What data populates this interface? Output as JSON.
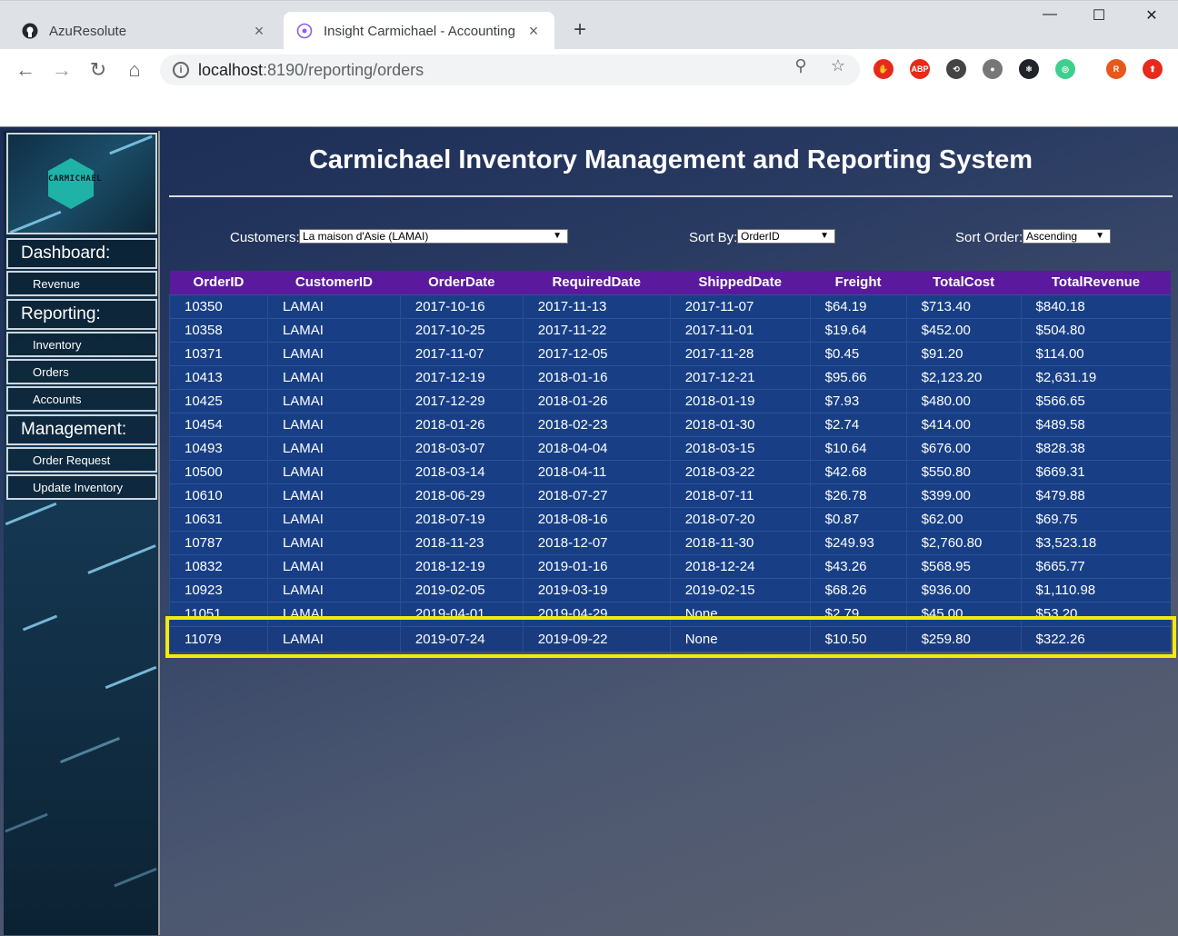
{
  "browser": {
    "tabs": [
      {
        "title": "AzuResolute",
        "icon": "github-icon",
        "active": false
      },
      {
        "title": "Insight Carmichael - Accounting",
        "icon": "app-favicon-icon",
        "active": true
      }
    ],
    "new_tab_glyph": "+",
    "window_controls": {
      "minimize": "—",
      "maximize": "☐",
      "close": "✕"
    },
    "nav": {
      "back": "←",
      "forward": "→",
      "reload": "↻",
      "home": "⌂"
    },
    "url_host": "localhost",
    "url_path": ":8190/reporting/orders",
    "omnibox_icons": {
      "zoom": "⚲",
      "bookmark": "☆"
    },
    "extensions": [
      {
        "name": "ublock-icon",
        "label": "✋",
        "color": "#e8291c"
      },
      {
        "name": "adblock-plus-icon",
        "label": "ABP",
        "color": "#e8291c"
      },
      {
        "name": "extension-circle-icon",
        "label": "⟲",
        "color": "#444444"
      },
      {
        "name": "extension-sphere-icon",
        "label": "●",
        "color": "#777777"
      },
      {
        "name": "react-devtools-icon",
        "label": "⚛",
        "color": "#20232a"
      },
      {
        "name": "extension-target-icon",
        "label": "◎",
        "color": "#3ecf8e"
      },
      {
        "name": "profile-avatar-icon",
        "label": "R",
        "color": "#e8571c"
      },
      {
        "name": "update-icon",
        "label": "⬆",
        "color": "#e8291c"
      }
    ]
  },
  "sidebar": {
    "logo_text": "CARMICHAEL",
    "sections": [
      {
        "heading": "Dashboard:",
        "items": [
          "Revenue"
        ]
      },
      {
        "heading": "Reporting:",
        "items": [
          "Inventory",
          "Orders",
          "Accounts"
        ]
      },
      {
        "heading": "Management:",
        "items": [
          "Order Request",
          "Update Inventory"
        ]
      }
    ]
  },
  "main": {
    "title": "Carmichael Inventory Management and Reporting System",
    "filters": {
      "customers_label": "Customers:",
      "customers_value": "La maison d'Asie (LAMAI)",
      "sort_by_label": "Sort By:",
      "sort_by_value": "OrderID",
      "sort_order_label": "Sort Order:",
      "sort_order_value": "Ascending",
      "dropdown_arrow": "▼"
    },
    "table": {
      "columns": [
        "OrderID",
        "CustomerID",
        "OrderDate",
        "RequiredDate",
        "ShippedDate",
        "Freight",
        "TotalCost",
        "TotalRevenue"
      ],
      "rows": [
        [
          "10350",
          "LAMAI",
          "2017-10-16",
          "2017-11-13",
          "2017-11-07",
          "$64.19",
          "$713.40",
          "$840.18"
        ],
        [
          "10358",
          "LAMAI",
          "2017-10-25",
          "2017-11-22",
          "2017-11-01",
          "$19.64",
          "$452.00",
          "$504.80"
        ],
        [
          "10371",
          "LAMAI",
          "2017-11-07",
          "2017-12-05",
          "2017-11-28",
          "$0.45",
          "$91.20",
          "$114.00"
        ],
        [
          "10413",
          "LAMAI",
          "2017-12-19",
          "2018-01-16",
          "2017-12-21",
          "$95.66",
          "$2,123.20",
          "$2,631.19"
        ],
        [
          "10425",
          "LAMAI",
          "2017-12-29",
          "2018-01-26",
          "2018-01-19",
          "$7.93",
          "$480.00",
          "$566.65"
        ],
        [
          "10454",
          "LAMAI",
          "2018-01-26",
          "2018-02-23",
          "2018-01-30",
          "$2.74",
          "$414.00",
          "$489.58"
        ],
        [
          "10493",
          "LAMAI",
          "2018-03-07",
          "2018-04-04",
          "2018-03-15",
          "$10.64",
          "$676.00",
          "$828.38"
        ],
        [
          "10500",
          "LAMAI",
          "2018-03-14",
          "2018-04-11",
          "2018-03-22",
          "$42.68",
          "$550.80",
          "$669.31"
        ],
        [
          "10610",
          "LAMAI",
          "2018-06-29",
          "2018-07-27",
          "2018-07-11",
          "$26.78",
          "$399.00",
          "$479.88"
        ],
        [
          "10631",
          "LAMAI",
          "2018-07-19",
          "2018-08-16",
          "2018-07-20",
          "$0.87",
          "$62.00",
          "$69.75"
        ],
        [
          "10787",
          "LAMAI",
          "2018-11-23",
          "2018-12-07",
          "2018-11-30",
          "$249.93",
          "$2,760.80",
          "$3,523.18"
        ],
        [
          "10832",
          "LAMAI",
          "2018-12-19",
          "2019-01-16",
          "2018-12-24",
          "$43.26",
          "$568.95",
          "$665.77"
        ],
        [
          "10923",
          "LAMAI",
          "2019-02-05",
          "2019-03-19",
          "2019-02-15",
          "$68.26",
          "$936.00",
          "$1,110.98"
        ],
        [
          "11051",
          "LAMAI",
          "2019-04-01",
          "2019-04-29",
          "None",
          "$2.79",
          "$45.00",
          "$53.20"
        ]
      ],
      "selected_row": [
        "11079",
        "LAMAI",
        "2019-07-24",
        "2019-09-22",
        "None",
        "$10.50",
        "$259.80",
        "$322.26"
      ]
    }
  },
  "colors": {
    "header_purple": "#5b1a9e",
    "row_blue": "#183f86",
    "highlight_yellow": "#f2ea0c"
  }
}
